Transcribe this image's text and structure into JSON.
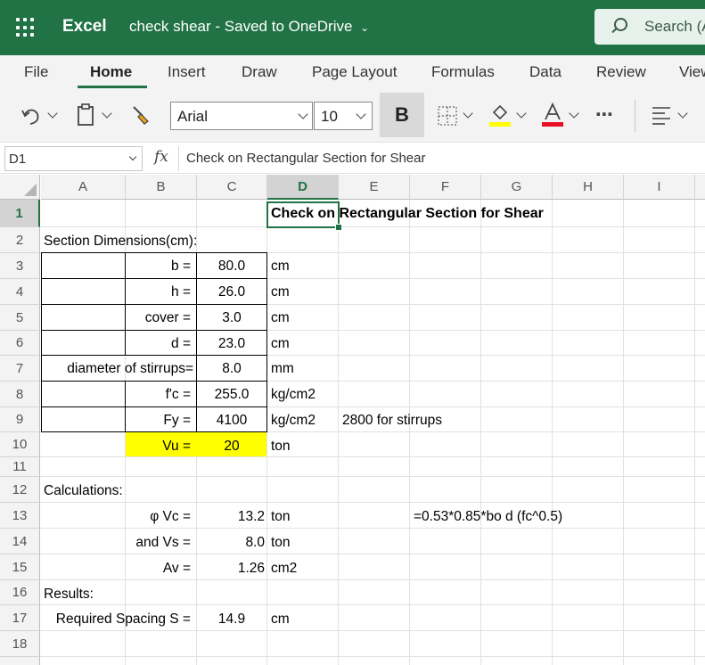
{
  "app": {
    "name": "Excel",
    "doc_title": "check shear",
    "saved_status": "Saved to OneDrive",
    "search_placeholder": "Search (A"
  },
  "ribbon": {
    "tabs": [
      "File",
      "Home",
      "Insert",
      "Draw",
      "Page Layout",
      "Formulas",
      "Data",
      "Review",
      "View"
    ],
    "active_tab": "Home",
    "font_name": "Arial",
    "font_size": "10",
    "bold_label": "B",
    "more_label": "⋯",
    "accent_color": "#217346",
    "highlight_color": "#ffff00",
    "font_color": "#e81123"
  },
  "formula_bar": {
    "name_box": "D1",
    "fx": "fx",
    "content": "Check on Rectangular Section for Shear"
  },
  "grid": {
    "columns": [
      "A",
      "B",
      "C",
      "D",
      "E",
      "F",
      "G",
      "H",
      "I"
    ],
    "rows": [
      "1",
      "2",
      "3",
      "4",
      "5",
      "6",
      "7",
      "8",
      "9",
      "10",
      "11",
      "12",
      "13",
      "14",
      "15",
      "16",
      "17",
      "18"
    ],
    "selected_cell": "D1"
  },
  "sheet": {
    "title": "Check on Rectangular Section for Shear",
    "section_label": "Section Dimensions(cm):",
    "inputs": [
      {
        "label": "b =",
        "value": "80.0",
        "unit": "cm"
      },
      {
        "label": "h =",
        "value": "26.0",
        "unit": "cm"
      },
      {
        "label": "cover =",
        "value": "3.0",
        "unit": "cm"
      },
      {
        "label": "d =",
        "value": "23.0",
        "unit": "cm"
      },
      {
        "label": "diameter of stirrups=",
        "value": "8.0",
        "unit": "mm"
      },
      {
        "label": "f'c =",
        "value": "255.0",
        "unit": "kg/cm2"
      },
      {
        "label": "Fy =",
        "value": "4100",
        "unit": "kg/cm2",
        "note": "2800 for stirrups"
      },
      {
        "label": "Vu =",
        "value": "20",
        "unit": "ton"
      }
    ],
    "calc_label": "Calculations:",
    "calcs": [
      {
        "label": "φ Vc =",
        "value": "13.2",
        "unit": "ton",
        "note": "=0.53*0.85*bo d (fc^0.5)"
      },
      {
        "label": "and Vs =",
        "value": "8.0",
        "unit": "ton"
      },
      {
        "label": "Av =",
        "value": "1.26",
        "unit": "cm2"
      }
    ],
    "results_label": "Results:",
    "result": {
      "label": "Required Spacing S =",
      "value": "14.9",
      "unit": "cm"
    }
  }
}
